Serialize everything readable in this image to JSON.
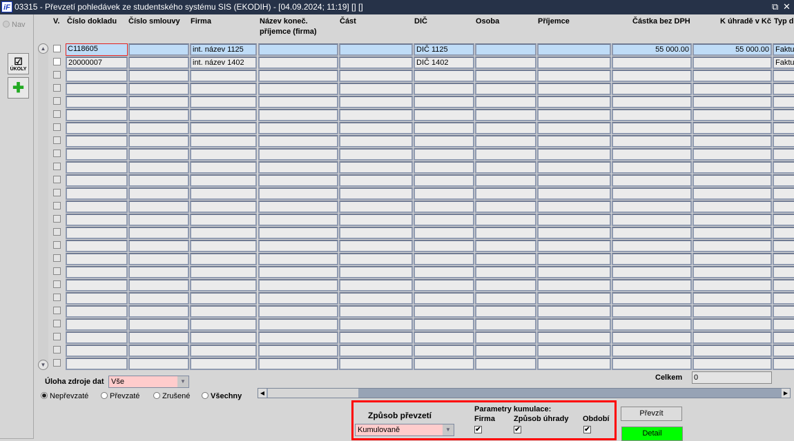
{
  "window": {
    "title": "03315 - Převzetí pohledávek ze studentského systému SIS (EKODIH) - [04.09.2024; 11:19]  []  []",
    "logo": "iF"
  },
  "left": {
    "nav": "Nav",
    "tasks_label": "ÚKOLY"
  },
  "columns": [
    "V.",
    "Číslo dokladu",
    "Číslo smlouvy",
    "Firma",
    "Název koneč. příjemce (firma)",
    "Část",
    "DIČ",
    "Osoba",
    "Příjemce",
    "Částka bez DPH",
    "K úhradě v Kč",
    "Typ d"
  ],
  "rows": [
    {
      "checked": false,
      "cislo_dokladu": "C118605",
      "cislo_smlouvy": "",
      "firma": "int. název 1125",
      "nazev": "",
      "cast": "",
      "dic": "DIČ 1125",
      "osoba": "",
      "prijemce": "",
      "castka": "55 000.00",
      "k_uhrade": "55 000.00",
      "typ": "Faktu"
    },
    {
      "checked": false,
      "cislo_dokladu": "20000007",
      "cislo_smlouvy": "",
      "firma": "int. název 1402",
      "nazev": "",
      "cast": "",
      "dic": "DIČ 1402",
      "osoba": "",
      "prijemce": "",
      "castka": "",
      "k_uhrade": "",
      "typ": "Faktu"
    }
  ],
  "empty_row_count": 23,
  "filter": {
    "label": "Úloha zdroje dat",
    "value": "Vše"
  },
  "radios": [
    {
      "label": "Nepřevzaté",
      "selected": true
    },
    {
      "label": "Převzaté",
      "selected": false
    },
    {
      "label": "Zrušené",
      "selected": false
    },
    {
      "label": "Všechny",
      "selected": false
    }
  ],
  "total": {
    "label": "Celkem",
    "value": "0"
  },
  "method": {
    "label": "Způsob převzetí",
    "value": "Kumulovaně"
  },
  "cumulation": {
    "title": "Parametry kumulace:",
    "items": [
      {
        "label": "Firma",
        "checked": true
      },
      {
        "label": "Způsob úhrady",
        "checked": true
      },
      {
        "label": "Období",
        "checked": true
      }
    ]
  },
  "buttons": {
    "prevzit": "Převzít",
    "detail": "Detail"
  },
  "colors": {
    "titlebar": "#263248",
    "selected_row": "#bfdcf7",
    "detail": "#00ff00",
    "highlight": "#ff0000"
  }
}
